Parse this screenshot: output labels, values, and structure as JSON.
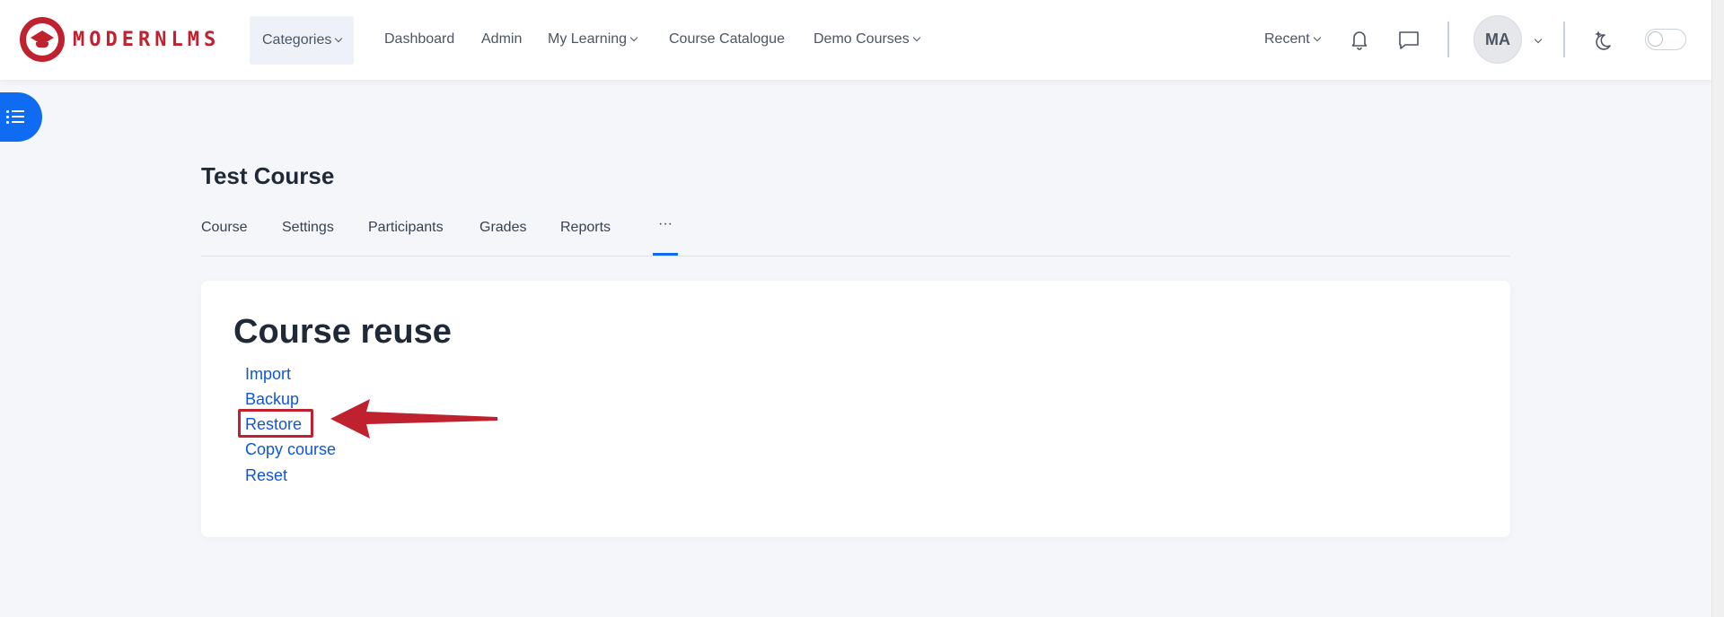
{
  "brand": {
    "name": "MODERNLMS",
    "color": "#c0212f"
  },
  "nav": {
    "categories": "Categories",
    "dashboard": "Dashboard",
    "admin": "Admin",
    "my_learning": "My Learning",
    "course_catalogue": "Course Catalogue",
    "demo_courses": "Demo Courses",
    "recent": "Recent"
  },
  "user": {
    "initials": "MA"
  },
  "page": {
    "title": "Test Course",
    "tabs": [
      "Course",
      "Settings",
      "Participants",
      "Grades",
      "Reports"
    ],
    "more_tab": "···",
    "active_tab": "more"
  },
  "card": {
    "title": "Course reuse",
    "links": [
      "Import",
      "Backup",
      "Restore",
      "Copy course",
      "Reset"
    ],
    "highlighted_link": "Restore"
  },
  "colors": {
    "accent": "#0f6cf2",
    "link": "#0f56d8",
    "annotation": "#c0212f",
    "background": "#f4f6fa"
  },
  "icons": [
    "graduation-cap-logo-icon",
    "bell-icon",
    "chat-icon",
    "theme-sparkle-moon-icon",
    "menu-list-icon",
    "chevron-down-icon"
  ]
}
